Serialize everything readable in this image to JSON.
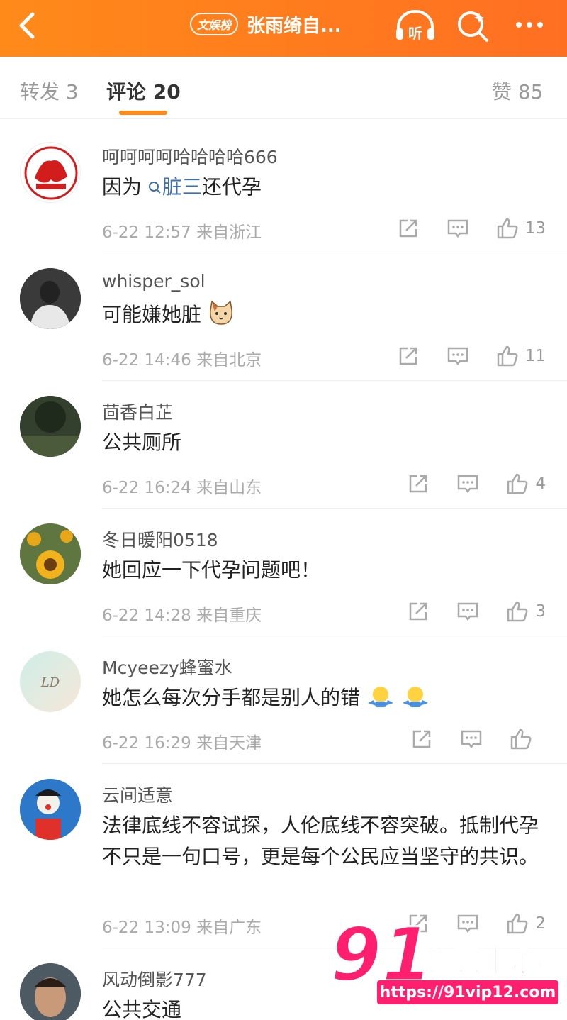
{
  "header": {
    "back_icon": "chevron-left-icon",
    "tag": "文娱榜",
    "title": "张雨绮自...",
    "listen_label": "听",
    "icons": [
      "headphones-icon",
      "search-sparkle-icon",
      "more-icon"
    ]
  },
  "tabs": {
    "repost": "转发 3",
    "comments": "评论 20",
    "likes": "赞 85"
  },
  "comments": [
    {
      "username": "呵呵呵呵哈哈哈哈666",
      "text_before": "因为 ",
      "keyword": "脏三",
      "text_after": "还代孕",
      "time": "6-22 12:57 来自浙江",
      "likes": "13"
    },
    {
      "username": "whisper_sol",
      "text": "可能嫌她脏",
      "emoji": "cat-face-icon",
      "time": "6-22 14:46 来自北京",
      "likes": "11"
    },
    {
      "username": "茴香白芷",
      "text": "公共厕所",
      "time": "6-22 16:24 来自山东",
      "likes": "4"
    },
    {
      "username": "冬日暖阳0518",
      "text": "她回应一下代孕问题吧！",
      "time": "6-22 14:28 来自重庆",
      "likes": "3"
    },
    {
      "username": "Mcyeezy蜂蜜水",
      "text": "她怎么每次分手都是别人的错",
      "emoji": "shrug-emoji-icon",
      "time": "6-22 16:29 来自天津",
      "likes": ""
    },
    {
      "username": "云间适意",
      "text": "法律底线不容试探，人伦底线不容突破。抵制代孕不只是一句口号，更是每个公民应当坚守的共识。",
      "time": "6-22 13:09 来自广东",
      "likes": "2"
    },
    {
      "username": "风动倒影777",
      "text": "公共交通"
    }
  ],
  "watermark": {
    "big": "91",
    "cn": "吃瓜中心",
    "url": "https://91vip12.com"
  },
  "colors": {
    "header_orange": "#ff7a1e",
    "accent_underline": "#ff8a1a",
    "keyword_blue": "#3e6fa8",
    "watermark_pink": "#ff1f6e"
  }
}
